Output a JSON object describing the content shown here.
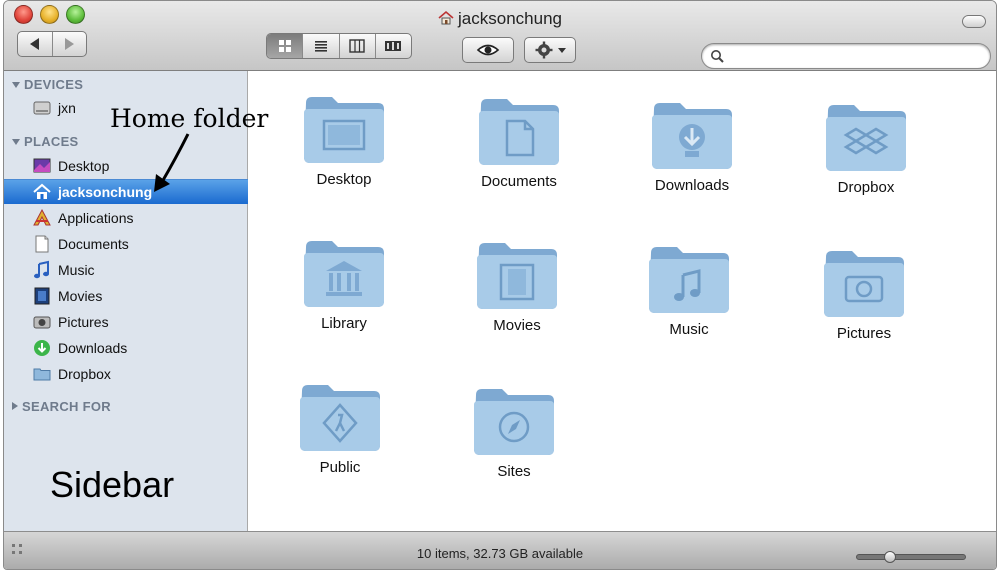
{
  "window": {
    "title": "jacksonchung"
  },
  "toolbar": {
    "back_icon": "back-arrow-icon",
    "forward_icon": "forward-arrow-icon",
    "view_modes": [
      "icon-view",
      "list-view",
      "column-view",
      "coverflow-view"
    ],
    "active_view": "icon-view",
    "quicklook_icon": "eye-icon",
    "action_icon": "gear-icon",
    "search_placeholder": ""
  },
  "sidebar": {
    "sections": [
      {
        "label": "DEVICES",
        "expanded": true
      },
      {
        "label": "PLACES",
        "expanded": true
      },
      {
        "label": "SEARCH FOR",
        "expanded": false
      }
    ],
    "devices": [
      {
        "label": "jxn",
        "icon": "hard-drive-icon"
      }
    ],
    "places": [
      {
        "label": "Desktop",
        "icon": "desktop-icon"
      },
      {
        "label": "jacksonchung",
        "icon": "home-icon",
        "selected": true
      },
      {
        "label": "Applications",
        "icon": "applications-icon"
      },
      {
        "label": "Documents",
        "icon": "documents-icon"
      },
      {
        "label": "Music",
        "icon": "music-icon"
      },
      {
        "label": "Movies",
        "icon": "movies-icon"
      },
      {
        "label": "Pictures",
        "icon": "pictures-icon"
      },
      {
        "label": "Downloads",
        "icon": "downloads-icon"
      },
      {
        "label": "Dropbox",
        "icon": "dropbox-icon"
      }
    ]
  },
  "annotations": {
    "home_folder": "Home folder",
    "sidebar": "Sidebar"
  },
  "folders": [
    {
      "label": "Desktop",
      "icon": "desktop-folder-icon"
    },
    {
      "label": "Documents",
      "icon": "documents-folder-icon"
    },
    {
      "label": "Downloads",
      "icon": "downloads-folder-icon"
    },
    {
      "label": "Dropbox",
      "icon": "dropbox-folder-icon"
    },
    {
      "label": "Library",
      "icon": "library-folder-icon"
    },
    {
      "label": "Movies",
      "icon": "movies-folder-icon"
    },
    {
      "label": "Music",
      "icon": "music-folder-icon"
    },
    {
      "label": "Pictures",
      "icon": "pictures-folder-icon"
    },
    {
      "label": "Public",
      "icon": "public-folder-icon"
    },
    {
      "label": "Sites",
      "icon": "sites-folder-icon"
    }
  ],
  "status": {
    "text": "10 items, 32.73 GB available"
  },
  "colors": {
    "selection": "#1a6ad0",
    "sidebar_bg": "#dde4ed",
    "folder_blue": "#8fb8dc"
  }
}
